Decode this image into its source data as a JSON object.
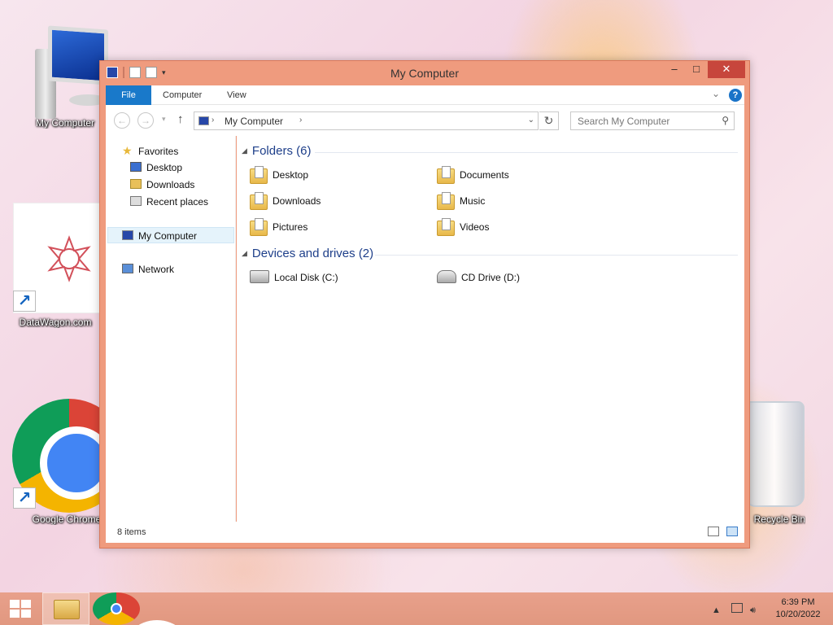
{
  "desktop": {
    "icons": [
      {
        "label": "My Computer"
      },
      {
        "label": "DataWagon.com"
      },
      {
        "label": "Google Chrome"
      },
      {
        "label": "Recycle Bin"
      }
    ]
  },
  "window": {
    "title": "My Computer",
    "controls": {
      "minimize": "–",
      "maximize": "□",
      "close": "✕"
    },
    "ribbon": {
      "file": "File",
      "computer": "Computer",
      "view": "View",
      "help": "?"
    },
    "address": {
      "crumb": "My Computer",
      "separator": "›"
    },
    "search": {
      "placeholder": "Search My Computer"
    },
    "nav": {
      "favorites": "Favorites",
      "items": [
        "Desktop",
        "Downloads",
        "Recent places"
      ],
      "my_computer": "My Computer",
      "network": "Network"
    },
    "groups": {
      "folders": "Folders (6)",
      "devices": "Devices and drives (2)"
    },
    "folders": [
      "Desktop",
      "Documents",
      "Downloads",
      "Music",
      "Pictures",
      "Videos"
    ],
    "drives": [
      "Local Disk (C:)",
      "CD Drive (D:)"
    ],
    "status": "8 items"
  },
  "taskbar": {
    "time": "6:39 PM",
    "date": "10/20/2022"
  }
}
